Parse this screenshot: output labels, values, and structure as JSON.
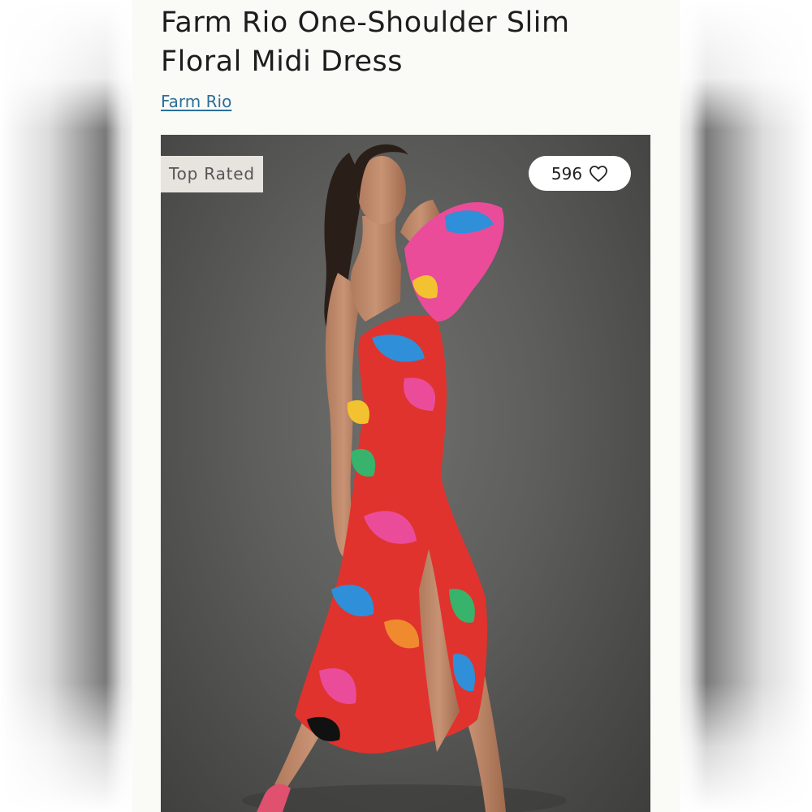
{
  "product": {
    "title": "Farm Rio One-Shoulder Slim Floral Midi Dress",
    "brand": "Farm Rio"
  },
  "hero": {
    "badge": "Top Rated",
    "likes_count": "596",
    "like_icon": "heart-outline-icon"
  },
  "colors": {
    "link": "#2b6f99",
    "background": "#fafaf7",
    "badge_bg": "#e7e4df",
    "dress_red": "#e0332e",
    "dress_pink": "#ea4c9a",
    "dress_blue": "#2f8fd8"
  }
}
